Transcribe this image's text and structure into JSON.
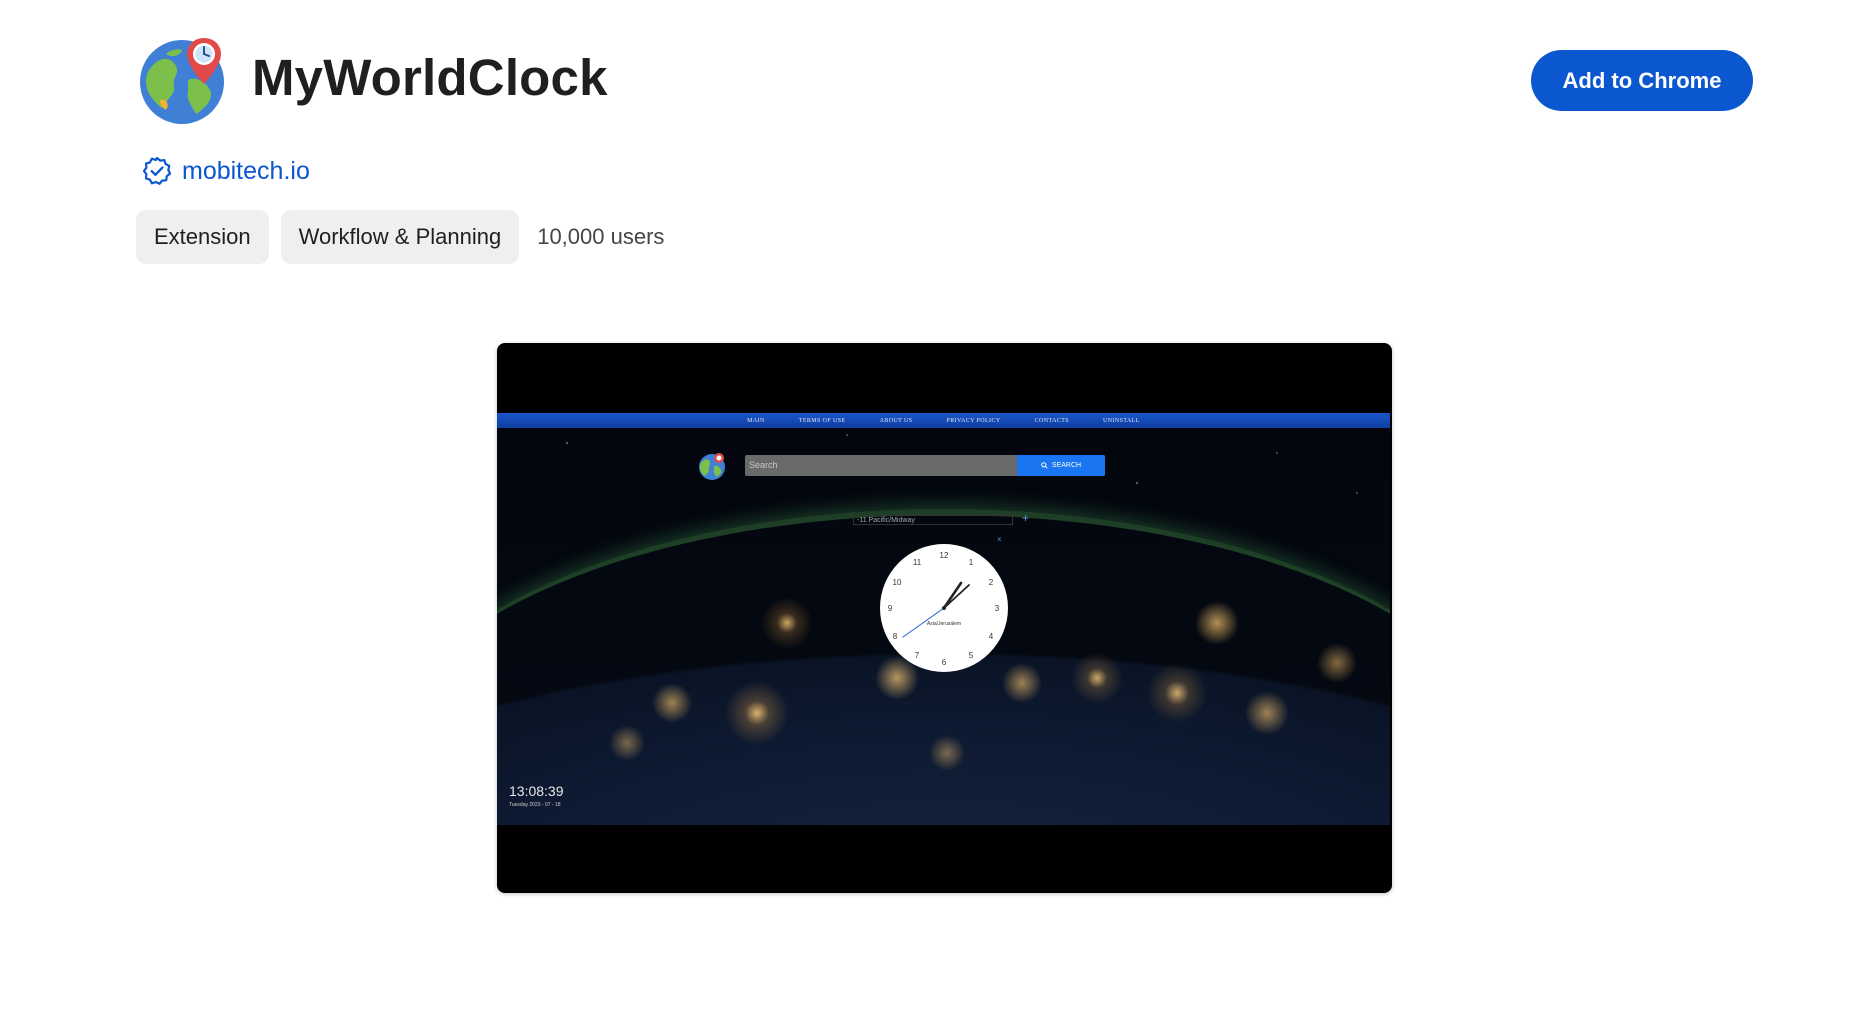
{
  "header": {
    "title": "MyWorldClock",
    "add_button_label": "Add to Chrome"
  },
  "publisher": {
    "name": "mobitech.io",
    "verified_icon": "verified-badge-icon"
  },
  "chips": {
    "type": "Extension",
    "category": "Workflow & Planning"
  },
  "users_count": "10,000 users",
  "screenshot": {
    "nav_items": [
      "MAIN",
      "TERMS OF USE",
      "ABOUT US",
      "PRIVACY POLICY",
      "CONTACTS",
      "UNINSTALL"
    ],
    "search_placeholder": "Search",
    "search_button": "SEARCH",
    "timezone_value": "-11 Pacific/Midway",
    "add_clock_symbol": "+",
    "close_symbol": "×",
    "clock_numbers": [
      "12",
      "1",
      "2",
      "3",
      "4",
      "5",
      "6",
      "7",
      "8",
      "9",
      "10",
      "11"
    ],
    "clock_city": "Asia/Jerusalem",
    "digital_time": "13:08:39",
    "date_line": "Tuesday 2023 - 07 - 18"
  },
  "colors": {
    "accent": "#0b57d0",
    "chip_bg": "#eef0ee",
    "site_nav": "#1a56c8",
    "site_search_button": "#1976f0"
  }
}
